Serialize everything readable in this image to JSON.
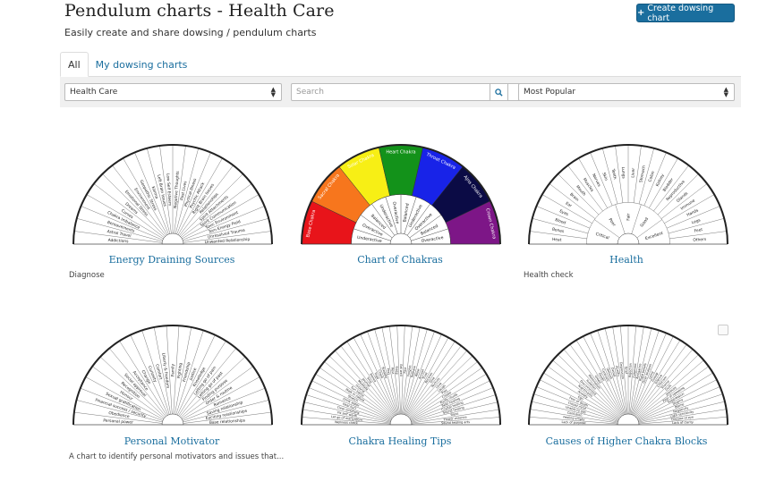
{
  "header": {
    "title": "Pendulum charts - Health Care",
    "subtitle": "Easily create and share dowsing / pendulum charts",
    "create_button": "Create dowsing chart",
    "create_icon": "plus-icon"
  },
  "tabs": [
    {
      "label": "All",
      "active": true
    },
    {
      "label": "My dowsing charts",
      "active": false
    }
  ],
  "filters": {
    "category": "Health Care",
    "search_placeholder": "Search",
    "sort": "Most Popular"
  },
  "cards": [
    {
      "title": "Energy Draining Sources",
      "description": "Diagnose",
      "labels": [
        "Addictions",
        "Astral Travel",
        "Bereavements",
        "Chakra Imbalance",
        "Curses",
        "Dreams",
        "Emotional Stress",
        "Environment",
        "Geopathic Stress",
        "Karma",
        "Left Brain Issues",
        "Low Self Esteem",
        "Negative Thoughts",
        "Past Lives",
        "Physical Illness",
        "Psychic Attack",
        "Right Brain Issues",
        "Relationships",
        "Spirit Attachments",
        "Spirit Communication",
        "Toxic Environment",
        "Torn Energy Field",
        "Unresolved Trauma",
        "Unwanted Relationship"
      ]
    },
    {
      "title": "Chart of Chakras",
      "description": "",
      "labels": [
        "Base Chakra",
        "Sacral Chakra",
        "Solar Chakra",
        "Heart Chakra",
        "Throat Chakra",
        "Ajna Chakra",
        "Crown Chakra"
      ],
      "inner_labels": [
        "Underactive",
        "Overactive",
        "Balanced",
        "Underactive",
        "Overactive",
        "Balanced",
        "Underactive",
        "Overactive",
        "Balanced",
        "Overactive"
      ],
      "colors": [
        "#e8141a",
        "#f7761d",
        "#f7ef15",
        "#13921a",
        "#1823e8",
        "#0b0b45",
        "#7d1687"
      ]
    },
    {
      "title": "Health",
      "description": "Health check",
      "labels": [
        "Heat",
        "Bones",
        "Blood",
        "Eyes",
        "Ear",
        "Brain",
        "Mouth",
        "Muscles",
        "Nerves",
        "Skin",
        "Teeth",
        "Lungs",
        "Liver",
        "Stomach",
        "Colon",
        "Kidney",
        "Bladder",
        "Reproductive",
        "Glands",
        "Immune",
        "Hands",
        "Legs",
        "Feet",
        "Others"
      ],
      "inner_labels": [
        "Critical",
        "Poor",
        "Fair",
        "Good",
        "Excellent"
      ],
      "scale": [
        "10",
        "20",
        "30",
        "40",
        "50",
        "60",
        "70",
        "80",
        "90",
        "100"
      ]
    },
    {
      "title": "Personal Motivator",
      "description": "A chart to identify personal motivators and issues that...",
      "labels": [
        "Personal power",
        "Obedience",
        "Financial success / security",
        "Sexual gratification",
        "Honour",
        "Recognition",
        "Social approval",
        "Acceptance",
        "Change",
        "Curiosity",
        "Comfort",
        "Liberty & freedom",
        "Family",
        "Fighting",
        "Friendship",
        "Justice",
        "Knowledge",
        "Letting go of pain",
        "Letting go of past",
        "Finding purpose",
        "Order & routine",
        "Romance",
        "Saving relationship",
        "Exciting relationships",
        "Base relationships"
      ]
    },
    {
      "title": "Chakra Healing Tips",
      "description": "",
      "labels": [
        "Wellness check",
        "Let go of martyrdom",
        "Fix self worth",
        "Clear emotions",
        "Heal hurt",
        "Drink water",
        "Stretch",
        "Walk in nature",
        "Sun bathe",
        "Ground",
        "Meditate",
        "Journal",
        "Sing",
        "Dance",
        "Yoga",
        "Chant",
        "Breathe",
        "Pray",
        "Rest",
        "Sleep",
        "Eat well",
        "Fast",
        "Forgive",
        "Release",
        "Allow",
        "Accept",
        "Trust",
        "Receive",
        "Give",
        "Nurture",
        "Love",
        "Laugh",
        "Play",
        "Create",
        "Purify rituals",
        "Reiki healing",
        "Crystal healing",
        "Sound healing",
        "Bless",
        "Flower essence",
        "Sound healing arts"
      ]
    },
    {
      "title": "Causes of Higher Chakra Blocks",
      "description": "",
      "labels": [
        "Lack of purpose",
        "Feeling empty",
        "Confusion",
        "Unable to see",
        "Closed mind",
        "Fear of death",
        "Ego",
        "Anxiety",
        "Nightmares",
        "Disconnected",
        "Isolation",
        "Materialism",
        "Greed",
        "Doubt",
        "Cynicism",
        "Distrust",
        "Denial",
        "Apathy",
        "Depression",
        "Grief",
        "Rejection",
        "Judgment",
        "Arrogance",
        "Rigid beliefs",
        "Over analysis",
        "Lying",
        "Gossip",
        "Silence",
        "Criticism",
        "Shame",
        "Guilt",
        "Jealousy",
        "Fear of speaking",
        "Suppression",
        "Dogma",
        "Blame",
        "Negativity",
        "Light sensitivity",
        "Disease of eye",
        "Lack of clarity"
      ]
    }
  ],
  "icons": {
    "search": "search-icon",
    "checkbox": "checkbox-icon"
  }
}
